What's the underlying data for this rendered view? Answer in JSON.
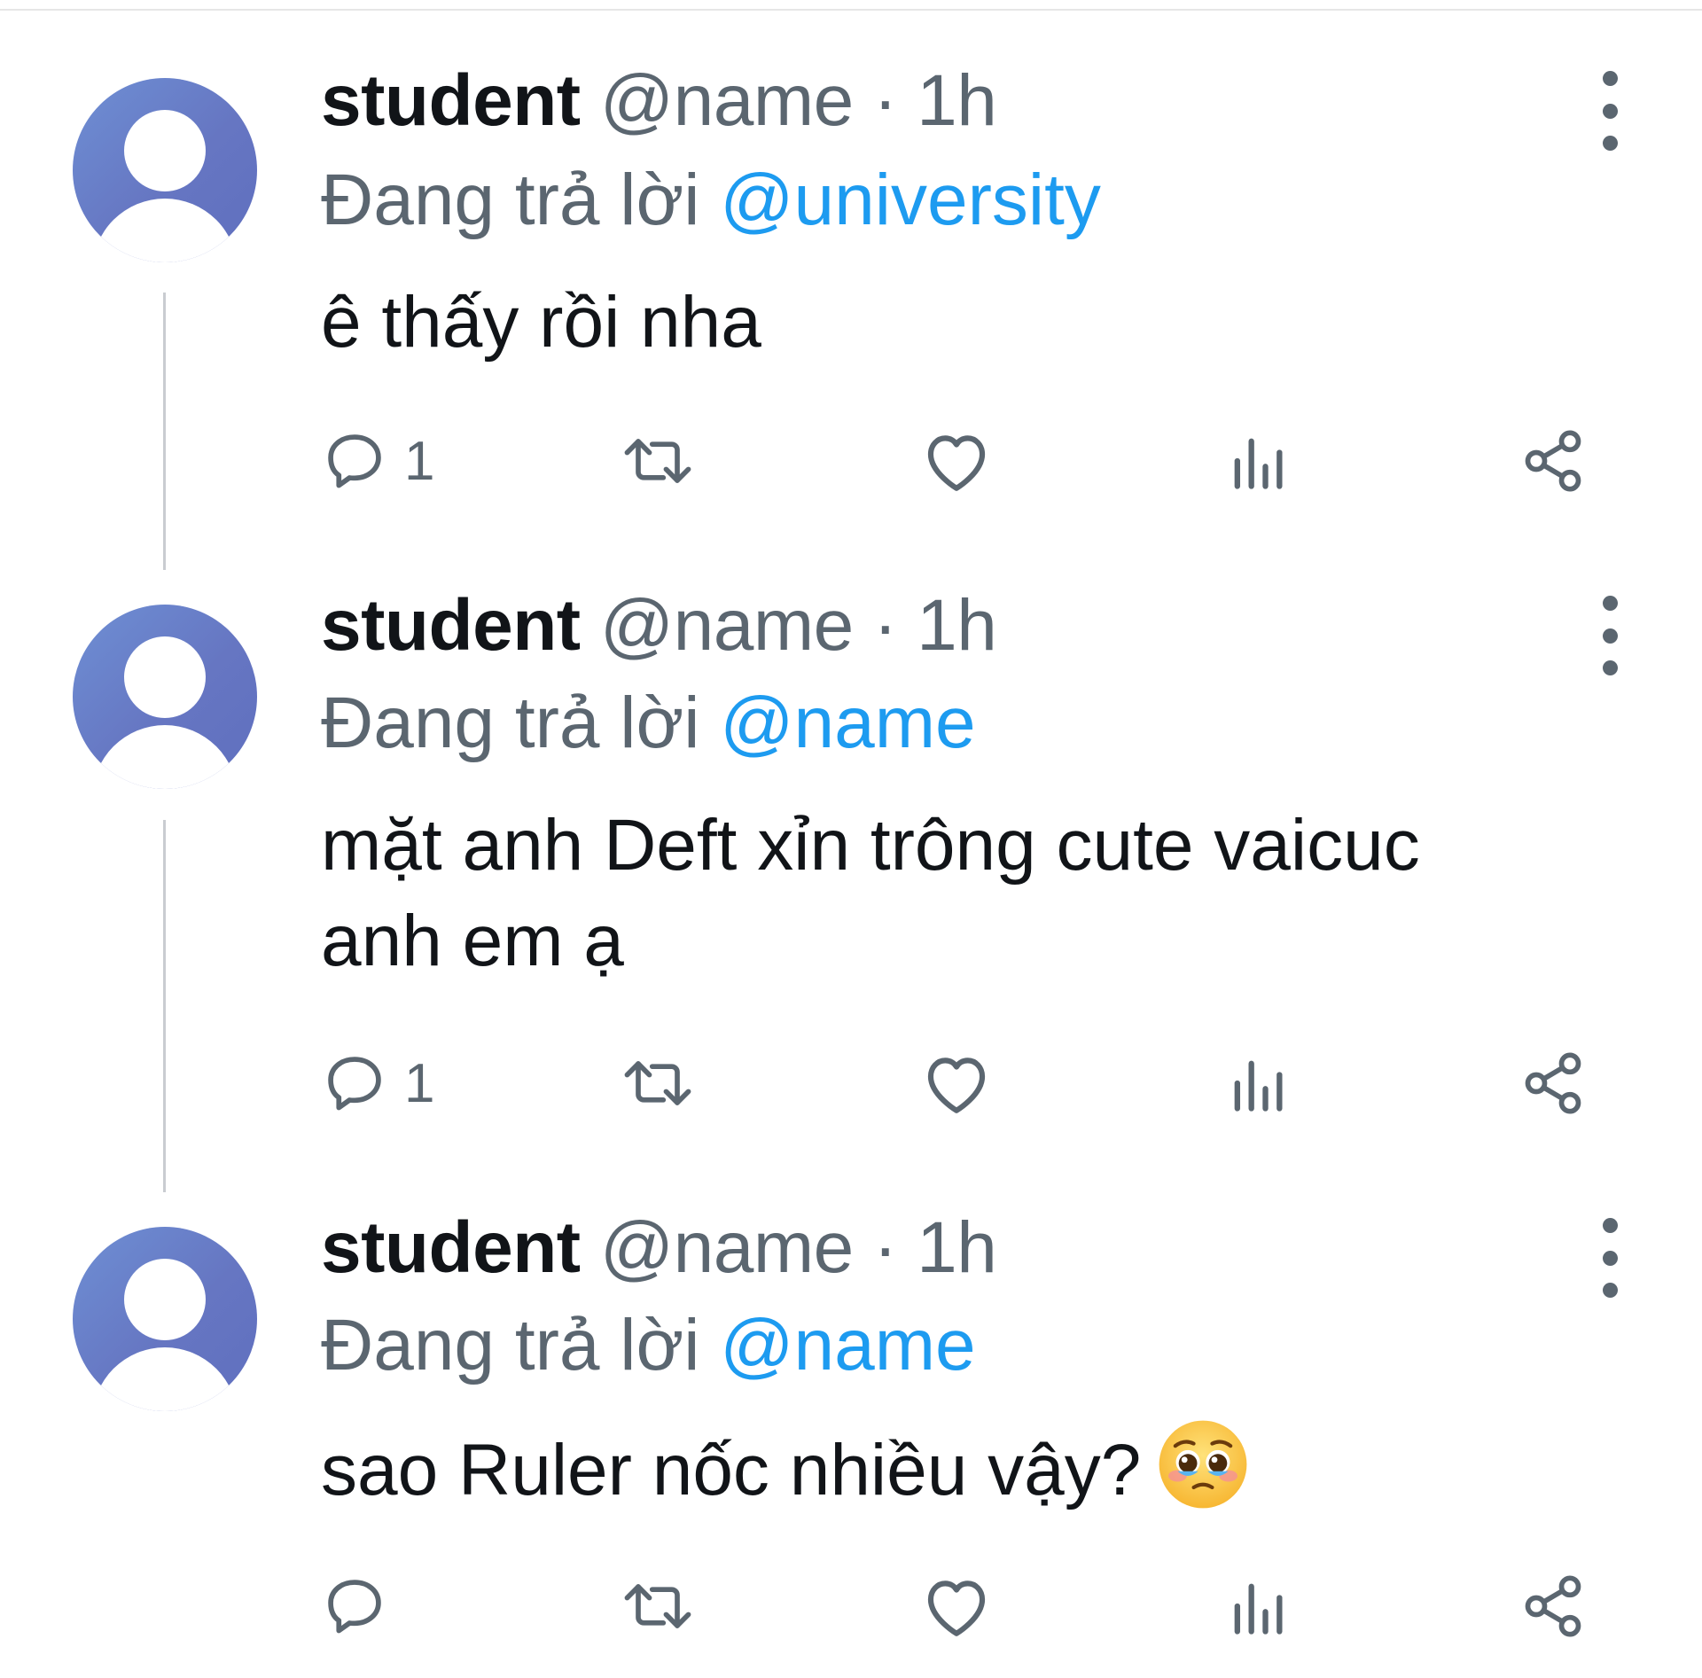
{
  "tweets": [
    {
      "author": "student",
      "handle": "@name",
      "separator": "·",
      "time": "1h",
      "reply_prefix": "Đang trả lời",
      "reply_to": "@university",
      "text_lines": [
        "ê thấy rồi nha"
      ],
      "reply_count": "1",
      "emoji": ""
    },
    {
      "author": "student",
      "handle": "@name",
      "separator": "·",
      "time": "1h",
      "reply_prefix": "Đang trả lời",
      "reply_to": "@name",
      "text_lines": [
        "mặt anh Deft xỉn trông cute vaicuc",
        "anh em ạ"
      ],
      "reply_count": "1",
      "emoji": ""
    },
    {
      "author": "student",
      "handle": "@name",
      "separator": "·",
      "time": "1h",
      "reply_prefix": "Đang trả lời",
      "reply_to": "@name",
      "text_lines": [
        "sao Ruler nốc nhiều vậy?"
      ],
      "reply_count": "",
      "emoji": "pleading-face-with-tears"
    }
  ],
  "icons": {
    "reply": "speech-bubble-icon",
    "retweet": "retweet-icon",
    "like": "heart-icon",
    "views": "bar-chart-icon",
    "share": "share-icon",
    "more": "more-vertical-icon"
  },
  "colors": {
    "text": "#111418",
    "secondary": "#5b6670",
    "mention": "#1d9bf0",
    "avatar": "#6676c2"
  }
}
